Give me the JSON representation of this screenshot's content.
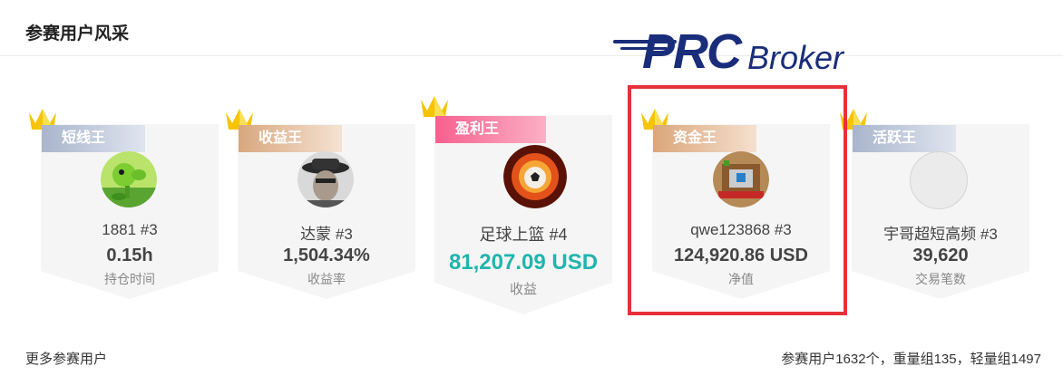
{
  "header": {
    "title": "参赛用户风采"
  },
  "logo": {
    "brand_main": "PRC",
    "brand_sub": "Broker"
  },
  "cards": [
    {
      "badge": "短线王",
      "name": "1881 #3",
      "value": "0.15h",
      "label": "持仓时间",
      "avatar": "peashooter-avatar"
    },
    {
      "badge": "收益王",
      "name": "达蒙 #3",
      "value": "1,504.34%",
      "label": "收益率",
      "avatar": "man-with-hat-avatar"
    },
    {
      "badge": "盈利王",
      "name": "足球上篮 #4",
      "value": "81,207.09 USD",
      "label": "收益",
      "avatar": "flaming-football-avatar"
    },
    {
      "badge": "资金王",
      "name": "qwe123868 #3",
      "value": "124,920.86 USD",
      "label": "净值",
      "avatar": "pixel-art-avatar"
    },
    {
      "badge": "活跃王",
      "name": "宇哥超短高频 #3",
      "value": "39,620",
      "label": "交易笔数",
      "avatar": "blank-avatar"
    }
  ],
  "footer": {
    "more_link": "更多参赛用户",
    "stats": "参赛用户1632个，重量组135，轻量组1497"
  },
  "colors": {
    "accent_teal": "#1fb5ad",
    "highlight_red": "#e8303a",
    "brand_blue": "#1a2d7a"
  }
}
